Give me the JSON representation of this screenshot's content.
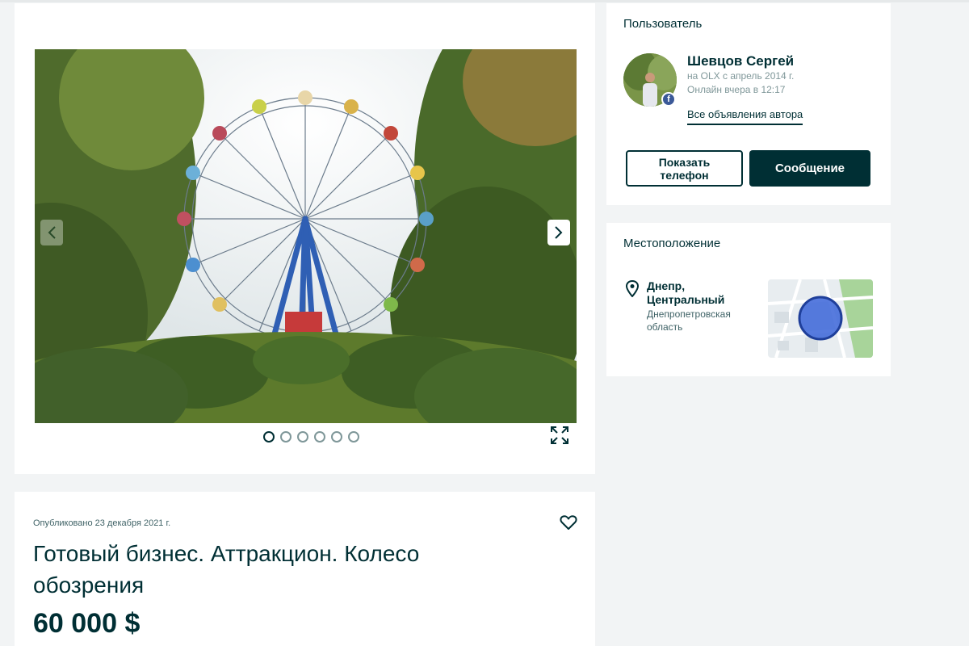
{
  "gallery": {
    "image_alt": "Колесо обозрения в парке",
    "photo_count": 6,
    "active_index": 0,
    "icons": {
      "prev": "chevron-left-icon",
      "next": "chevron-right-icon",
      "expand": "expand-icon"
    }
  },
  "ad": {
    "posted": "Опубликовано 23 декабря 2021 г.",
    "title": "Готовый бизнес. Аттракцион. Колесо обозрения",
    "price": "60 000 $",
    "favorite_icon": "heart-icon"
  },
  "user": {
    "section_label": "Пользователь",
    "name": "Шевцов Сергей",
    "since": "на OLX с апрель 2014 г.",
    "online": "Онлайн вчера в 12:17",
    "all_ads_link": "Все объявления автора",
    "badge_letter": "f",
    "show_phone_line1": "Показать",
    "show_phone_line2": "телефон",
    "message_button": "Сообщение"
  },
  "location": {
    "section_label": "Местоположение",
    "city_line1": "Днепр,",
    "city_line2": "Центральный",
    "region": "Днепропетровская область",
    "pin_icon": "map-pin-icon"
  },
  "colors": {
    "primary": "#002f34",
    "page_bg": "#f2f4f5",
    "map_circle": "#3a64d8"
  }
}
